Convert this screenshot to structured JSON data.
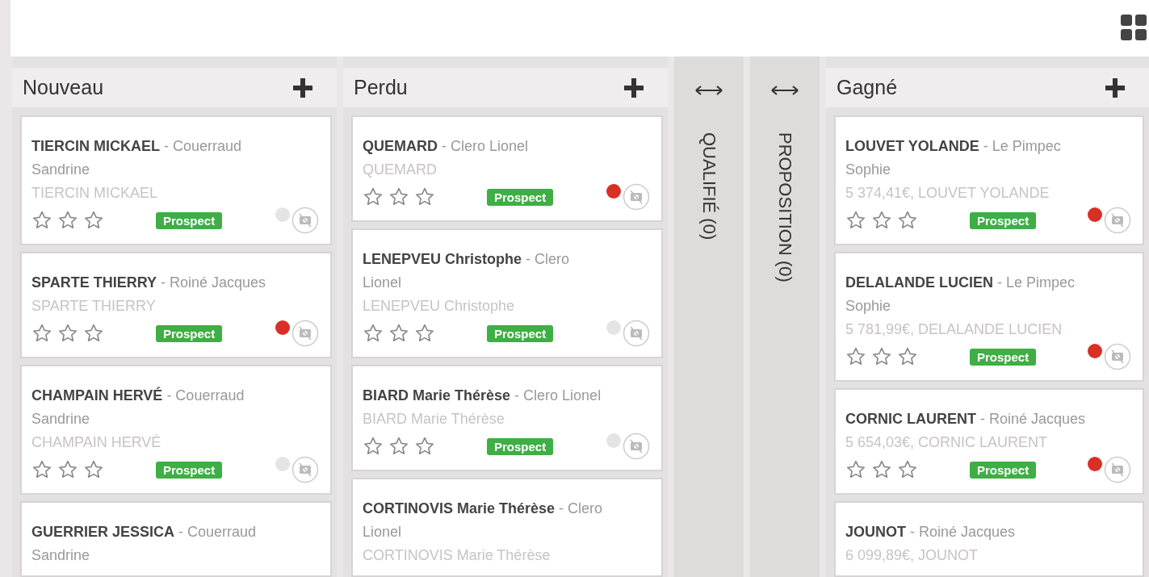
{
  "columns": [
    {
      "kind": "expanded",
      "title": "Nouveau",
      "cards": [
        {
          "name": "TIERCIN MICKAEL",
          "owner": "- Couerraud Sandrine",
          "subtitle": "TIERCIN MICKAEL",
          "footer": {
            "stars": 0,
            "tag": "Prospect",
            "color": "#e4e4e4"
          }
        },
        {
          "name": "SPARTE THIERRY",
          "owner": "- Roiné Jacques",
          "subtitle": "SPARTE THIERRY",
          "footer": {
            "stars": 0,
            "tag": "Prospect",
            "color": "#d93025"
          }
        },
        {
          "name": "CHAMPAIN HERVÉ",
          "owner": "- Couerraud Sandrine",
          "subtitle": "CHAMPAIN HERVÉ",
          "footer": {
            "stars": 0,
            "tag": "Prospect",
            "color": "#e4e4e4"
          }
        },
        {
          "name": "GUERRIER JESSICA",
          "owner": "- Couerraud Sandrine"
        }
      ]
    },
    {
      "kind": "expanded",
      "title": "Perdu",
      "cards": [
        {
          "name": "QUEMARD",
          "owner": "- Clero Lionel",
          "subtitle": "QUEMARD",
          "footer": {
            "stars": 0,
            "tag": "Prospect",
            "color": "#d93025"
          }
        },
        {
          "name": "LENEPVEU Christophe",
          "owner": "- Clero Lionel",
          "subtitle": "LENEPVEU Christophe",
          "footer": {
            "stars": 0,
            "tag": "Prospect",
            "color": "#e4e4e4"
          }
        },
        {
          "name": "BIARD Marie Thérèse",
          "owner": "- Clero Lionel",
          "subtitle": "BIARD Marie Thérèse",
          "footer": {
            "stars": 0,
            "tag": "Prospect",
            "color": "#e4e4e4"
          }
        },
        {
          "name": "CORTINOVIS Marie Thérèse",
          "owner": "- Clero Lionel",
          "subtitle": "CORTINOVIS Marie Thérèse"
        }
      ]
    },
    {
      "kind": "collapsed",
      "title": "QUALIFIÉ (0)"
    },
    {
      "kind": "collapsed",
      "title": "PROPOSITION (0)"
    },
    {
      "kind": "expanded",
      "title": "Gagné",
      "cards": [
        {
          "name": "LOUVET YOLANDE",
          "owner": "- Le Pimpec Sophie",
          "subtitle": "5 374,41€, LOUVET YOLANDE",
          "footer": {
            "stars": 0,
            "tag": "Prospect",
            "color": "#d93025"
          }
        },
        {
          "name": "DELALANDE LUCIEN",
          "owner": "- Le Pimpec Sophie",
          "subtitle": "5 781,99€, DELALANDE LUCIEN",
          "footer": {
            "stars": 0,
            "tag": "Prospect",
            "color": "#d93025"
          }
        },
        {
          "name": "CORNIC LAURENT",
          "owner": "- Roiné Jacques",
          "subtitle": "5 654,03€, CORNIC LAURENT",
          "footer": {
            "stars": 0,
            "tag": "Prospect",
            "color": "#d93025"
          }
        },
        {
          "name": "JOUNOT",
          "owner": "- Roiné Jacques",
          "subtitle": "6 099,89€, JOUNOT"
        }
      ]
    }
  ]
}
